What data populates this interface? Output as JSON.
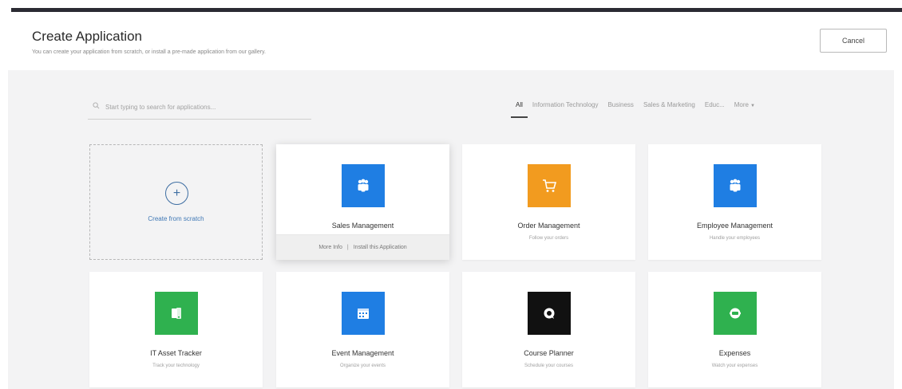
{
  "header": {
    "title": "Create Application",
    "subtitle": "You can create your application from scratch, or install a pre-made application from our gallery.",
    "cancel_label": "Cancel"
  },
  "search": {
    "placeholder": "Start typing to search for applications..."
  },
  "tabs": [
    {
      "label": "All",
      "active": true
    },
    {
      "label": "Information Technology"
    },
    {
      "label": "Business"
    },
    {
      "label": "Sales & Marketing"
    },
    {
      "label": "Educ..."
    },
    {
      "label": "More"
    }
  ],
  "scratch": {
    "label": "Create from scratch",
    "icon": "plus-circle-icon"
  },
  "hover_actions": {
    "more_info": "More Info",
    "install": "Install this Application"
  },
  "apps": [
    {
      "name": "Sales Management",
      "desc": "",
      "color": "#1f7ee3",
      "icon": "people-icon"
    },
    {
      "name": "Order Management",
      "desc": "Follow your orders",
      "color": "#f29b1f",
      "icon": "cart-icon"
    },
    {
      "name": "Employee Management",
      "desc": "Handle your employees",
      "color": "#1f7ee3",
      "icon": "people-icon"
    },
    {
      "name": "IT Asset Tracker",
      "desc": "Track your technology",
      "color": "#2fb14f",
      "icon": "device-icon"
    },
    {
      "name": "Event Management",
      "desc": "Organize your events",
      "color": "#1f7ee3",
      "icon": "calendar-icon"
    },
    {
      "name": "Course Planner",
      "desc": "Schedule your courses",
      "color": "#111111",
      "icon": "course-icon"
    },
    {
      "name": "Expenses",
      "desc": "Watch your expenses",
      "color": "#2fb14f",
      "icon": "expense-icon"
    }
  ]
}
